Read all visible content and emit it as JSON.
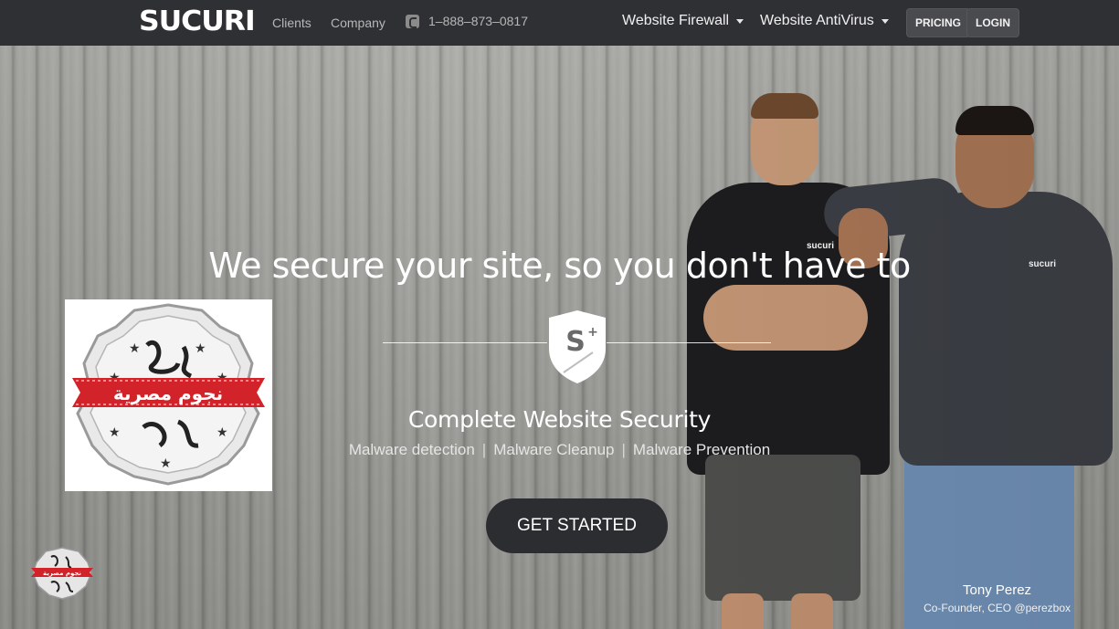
{
  "nav": {
    "logo": "SUCURI",
    "links": [
      "Clients",
      "Company"
    ],
    "phone": "1–888–873–0817",
    "dropdowns": [
      "Website Firewall",
      "Website AntiVirus"
    ],
    "buttons": [
      "PRICING",
      "LOGIN"
    ]
  },
  "hero": {
    "headline": "We secure your site, so you don't have to",
    "subhead": "Complete Website Security",
    "features": [
      "Malware detection",
      "Malware Cleanup",
      "Malware Prevention"
    ],
    "cta": "GET STARTED",
    "shirt_logo": "sucuri",
    "caption": {
      "name": "Tony Perez",
      "title": "Co-Founder, CEO @perezbox"
    }
  },
  "watermark": {
    "text": "نجوم مصرية"
  },
  "colors": {
    "nav_bg": "#2f3033",
    "cta_bg": "#2c2d31",
    "stamp_red": "#d2232a"
  },
  "icons": [
    "phone-icon",
    "chevron-down-icon",
    "shield-logo-icon"
  ]
}
